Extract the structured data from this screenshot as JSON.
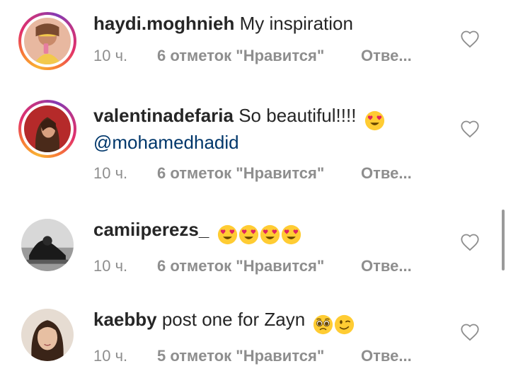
{
  "comments": [
    {
      "username": "haydi.moghnieh",
      "text": "My inspiration",
      "mention": "",
      "emojis": [],
      "time": "10 ч.",
      "likes": "6 отметок \"Нравится\"",
      "reply": "Отве...",
      "avatar_ring": true,
      "heart_icon": "heart-outline-icon"
    },
    {
      "username": "valentinadefaria",
      "text": "So beautiful!!!!",
      "mention": "@mohamedhadid",
      "emojis": [
        "heart-eyes-emoji"
      ],
      "time": "10 ч.",
      "likes": "6 отметок \"Нравится\"",
      "reply": "Отве...",
      "avatar_ring": true,
      "heart_icon": "heart-outline-icon"
    },
    {
      "username": "camiiperezs_",
      "text": "",
      "mention": "",
      "emojis": [
        "heart-eyes-emoji",
        "heart-eyes-emoji",
        "heart-eyes-emoji",
        "heart-eyes-emoji"
      ],
      "time": "10 ч.",
      "likes": "6 отметок \"Нравится\"",
      "reply": "Отве...",
      "avatar_ring": false,
      "heart_icon": "heart-outline-icon"
    },
    {
      "username": "kaebby",
      "text": "post one for Zayn",
      "mention": "",
      "emojis": [
        "pleading-face-emoji",
        "winking-face-emoji"
      ],
      "time": "10 ч.",
      "likes": "5 отметок \"Нравится\"",
      "reply": "Отве...",
      "avatar_ring": false,
      "heart_icon": "heart-outline-icon"
    }
  ],
  "colors": {
    "username": "#262626",
    "mention": "#00376b",
    "meta": "#8e8e8e",
    "story_ring_start": "#f9b233",
    "story_ring_end": "#c13584"
  }
}
